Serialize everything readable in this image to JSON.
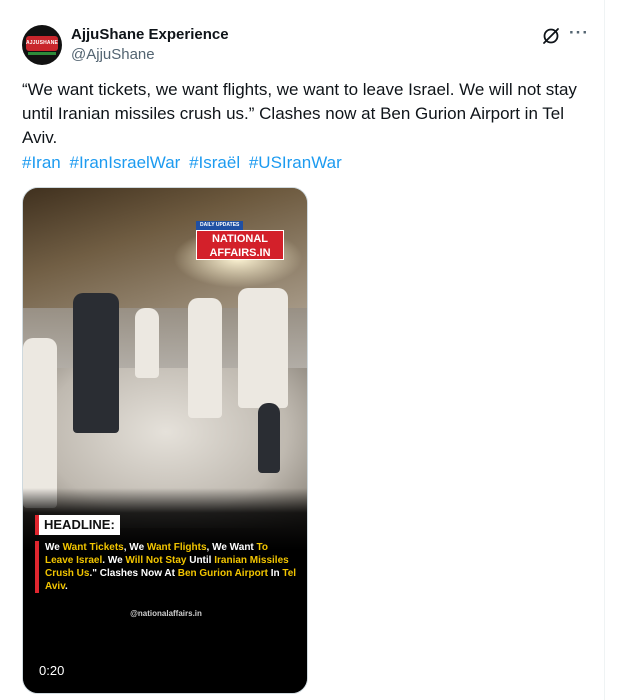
{
  "author": {
    "display_name": "AjjuShane Experience",
    "handle": "@AjjuShane",
    "avatar_text": "AJJUSHANE"
  },
  "tweet": {
    "text": "“We want tickets, we want flights, we want to leave Israel. We will not stay until Iranian missiles crush us.” Clashes now at Ben Gurion Airport in Tel Aviv.",
    "hashtags": [
      "#Iran",
      "#IranIsraelWar",
      "#Israël",
      "#USIranWar"
    ]
  },
  "actions": {
    "grok_icon": "grok-icon",
    "more_icon": "more-icon",
    "more_glyph": "···"
  },
  "video": {
    "duration": "0:20",
    "logo_top": "DAILY UPDATES",
    "logo_line1": "NATIONAL",
    "logo_line2": "AFFAIRS.IN",
    "headline_label": "HEADLINE:",
    "headline_parts": [
      {
        "t": "We ",
        "y": false
      },
      {
        "t": "Want Tickets",
        "y": true
      },
      {
        "t": ", We ",
        "y": false
      },
      {
        "t": "Want Flights",
        "y": true
      },
      {
        "t": ", We Want ",
        "y": false
      },
      {
        "t": "To Leave Israel",
        "y": true
      },
      {
        "t": ". We ",
        "y": false
      },
      {
        "t": "Will Not Stay",
        "y": true
      },
      {
        "t": " Until ",
        "y": false
      },
      {
        "t": "Iranian Missiles Crush Us",
        "y": true
      },
      {
        "t": ".\" Clashes Now At ",
        "y": false
      },
      {
        "t": "Ben Gurion Airport",
        "y": true
      },
      {
        "t": " In ",
        "y": false
      },
      {
        "t": "Tel Aviv",
        "y": true
      },
      {
        "t": ".",
        "y": false
      }
    ],
    "credit": "@nationalaffairs.in"
  },
  "colors": {
    "link": "#1d9bf0",
    "secondary_text": "#536471",
    "headline_accent": "#e0262f",
    "headline_highlight": "#f2c500"
  }
}
